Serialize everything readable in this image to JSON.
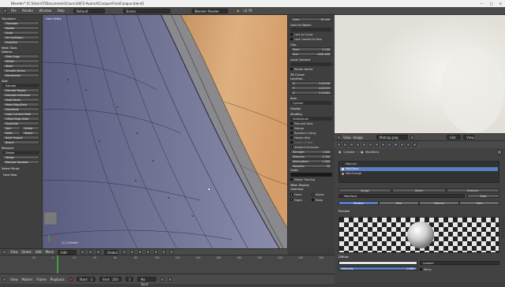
{
  "titlebar": {
    "title": "Blender* [C:\\Users\\T\\Documents\\Cours3d\\F2-Avancé\\Casque\\FinalCasque.blend]",
    "controls": [
      "—",
      "□",
      "✕"
    ]
  },
  "infobar": {
    "menu": [
      "File",
      "Render",
      "Window",
      "Help"
    ],
    "layout": "Default",
    "scene": "Scene",
    "engine": "Blender Render",
    "version": "v2.79"
  },
  "toolshelf": {
    "transform_header": "Transform",
    "transform": [
      "Translate",
      "Rotate",
      "Scale",
      "Shrink/Fatten",
      "Push/Pull"
    ],
    "mesh_tools_header": "Mesh Tools",
    "deform_label": "Deform:",
    "deform": [
      "Slide Edge",
      "Vertex",
      "Noise",
      "Smooth Vertex",
      "Randomize"
    ],
    "add_label": "Add:",
    "add_select": "Extrude",
    "add": [
      "Extrude Region",
      "Extrude Individual",
      "Inset Faces",
      "Make Edge/Face",
      "Subdivide",
      "Loop Cut and Slide",
      "Offset Edge Slide",
      "Duplicate"
    ],
    "spin_row": [
      "Spin",
      "Screw"
    ],
    "knife_row": [
      "Knife",
      "Select"
    ],
    "extra": [
      "Knife Project",
      "Bisect"
    ],
    "remove_label": "Remove:",
    "remove": [
      "Delete",
      "Merge",
      "Remove Doubles"
    ],
    "select_mirror": "Select Mirror",
    "face_step": "Face Step"
  },
  "viewport": {
    "label": "User Ortho",
    "object_label": "(1) Cylinder",
    "footer": [
      "View",
      "Select",
      "Add",
      "Mesh"
    ],
    "mode": "Edit Mode",
    "pivot": "Global"
  },
  "npanel": {
    "lens_field": {
      "label": "Lens:",
      "value": "35 mm"
    },
    "lock_to_object": "Lock to Object:",
    "lock_cursor": "Lock to Cursor",
    "lock_camera": "Lock Camera to View",
    "clip_header": "Clip:",
    "clip_start": {
      "label": "Start:",
      "value": "0.100"
    },
    "clip_end": {
      "label": "End:",
      "value": "1000.000"
    },
    "local_camera": "Local Camera:",
    "render_border": "Render Border",
    "cursor_header": "3D Cursor",
    "location_label": "Location:",
    "loc_x": {
      "label": "X:",
      "value": "0.04326"
    },
    "loc_y": {
      "label": "Y:",
      "value": "0.01223"
    },
    "loc_z": {
      "label": "Z:",
      "value": "0.01684"
    },
    "item_header": "Item",
    "item_name": "Cylinder",
    "display_header": "Display",
    "shading_header": "Shading",
    "shading_mode": "Multitexture",
    "shading_checks": [
      {
        "label": "Textured Solid",
        "on": false
      },
      {
        "label": "Matcap",
        "on": false
      },
      {
        "label": "Backface Culling",
        "on": false
      },
      {
        "label": "Hidden Wire",
        "on": false
      },
      {
        "label": "Depth Of Field",
        "on": false
      },
      {
        "label": "Ambient Occlusion",
        "on": true
      }
    ],
    "ao_fields": [
      {
        "label": "Strength:",
        "value": "1.000"
      },
      {
        "label": "Distance:",
        "value": "0.200"
      },
      {
        "label": "Attenuation:",
        "value": "1.000"
      },
      {
        "label": "Samples:",
        "value": "20"
      }
    ],
    "color_label": "Color:",
    "motion_tracking": "Motion Tracking",
    "mesh_display": "Mesh Display",
    "overlays_label": "Overlays:",
    "overlay_checks": [
      "Faces",
      "Seams",
      "Edges",
      "Sharp"
    ]
  },
  "render_window": {
    "header": [
      "View",
      "Image",
      "Image"
    ],
    "image_name": "Matcap.png",
    "slot": "Slot 1",
    "view": "View"
  },
  "properties": {
    "context_object": "Cylinder",
    "context_material": "Mat.Blanc",
    "slots": [
      {
        "name": "Mat.noir",
        "selected": false
      },
      {
        "name": "Mat.Blanc",
        "selected": true
      },
      {
        "name": "Mat.Orange",
        "selected": false
      }
    ],
    "slot_buttons": [
      "Assign",
      "Select",
      "Deselect"
    ],
    "material_field": "Mat.Blanc",
    "data_label": "Data",
    "tabs": [
      {
        "label": "Surface",
        "on": true
      },
      {
        "label": "Wire",
        "on": false
      },
      {
        "label": "Volume",
        "on": false
      },
      {
        "label": "Halo",
        "on": false
      }
    ],
    "preview_header": "Preview",
    "diffuse_header": "Diffuse",
    "diffuse_shader": "Lambert",
    "intensity": {
      "label": "Intensity:",
      "value": "0.800"
    },
    "ramp_label": "Ramp"
  },
  "timeline": {
    "ticks": [
      "-20",
      "0",
      "20",
      "40",
      "60",
      "80",
      "100",
      "120",
      "140",
      "160",
      "180",
      "200",
      "220",
      "240",
      "260"
    ],
    "footer": [
      "View",
      "Marker",
      "Frame",
      "Playback"
    ],
    "start": {
      "label": "Start:",
      "value": "1"
    },
    "end": {
      "label": "End:",
      "value": "250"
    },
    "current": "1",
    "sync": "No Sync"
  },
  "colors": {
    "accent": "#5680c2",
    "mesh_orange": "#d7a574",
    "mesh_blue": "#6b6e93",
    "playhead": "#3f9e3f"
  }
}
